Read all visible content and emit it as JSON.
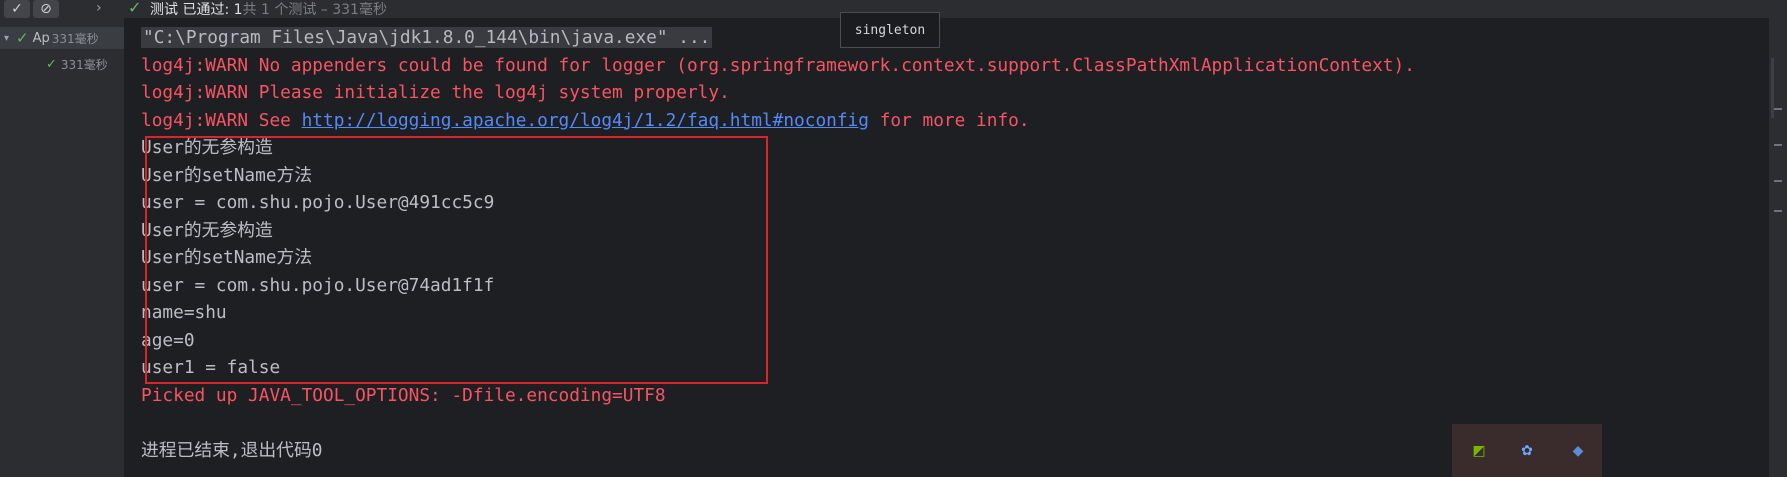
{
  "toolbar": {
    "rerun_icon": "check-icon",
    "stop_icon": "stop-icon",
    "expand_icon": "chevron-right-icon",
    "status_bold": "测试 已通过: 1",
    "status_detail": "共 1 个测试 – 331毫秒"
  },
  "tree": {
    "root": {
      "label": "Ap",
      "duration": "331毫秒"
    },
    "child": {
      "duration": "331毫秒"
    }
  },
  "tooltip": "singleton",
  "console": {
    "command": "\"C:\\Program Files\\Java\\jdk1.8.0_144\\bin\\java.exe\" ...",
    "warn1": "log4j:WARN No appenders could be found for logger (org.springframework.context.support.ClassPathXmlApplicationContext).",
    "warn2": "log4j:WARN Please initialize the log4j system properly.",
    "warn3_prefix": "log4j:WARN See ",
    "warn3_link": "http://logging.apache.org/log4j/1.2/faq.html#noconfig",
    "warn3_suffix": " for more info.",
    "output": [
      "User的无参构造",
      "User的setName方法",
      "user = com.shu.pojo.User@491cc5c9",
      "User的无参构造",
      "User的setName方法",
      "user = com.shu.pojo.User@74ad1f1f",
      "name=shu",
      "age=0",
      "user1 = false"
    ],
    "java_options": "Picked up JAVA_TOOL_OPTIONS: -Dfile.encoding=UTF8",
    "exit": "进程已结束,退出代码0"
  },
  "colors": {
    "console_bg": "#1e1f22",
    "warn_red": "#f75464",
    "link_blue": "#548af7",
    "pass_green": "#5fb865",
    "highlight_box": "#d9252b"
  },
  "tray_icons": [
    "nvidia-icon",
    "app-icon",
    "cat-icon"
  ]
}
